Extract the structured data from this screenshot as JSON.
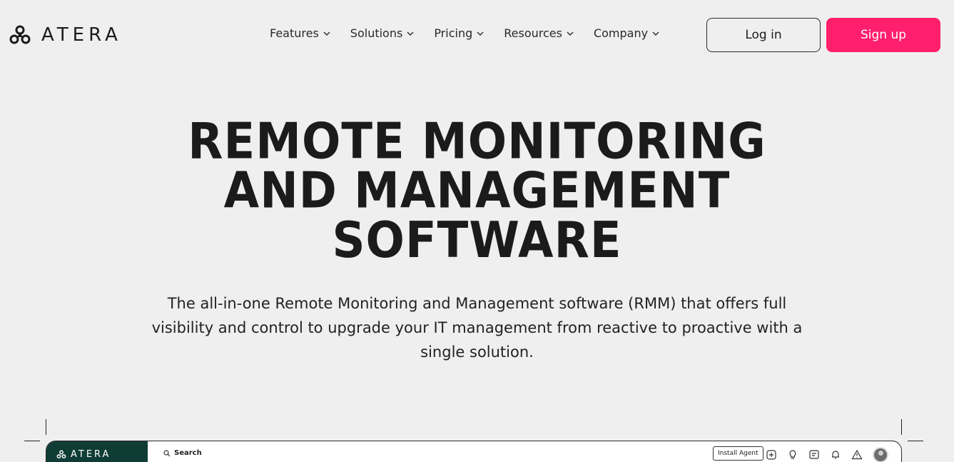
{
  "header": {
    "brand": "ATERA",
    "nav": [
      {
        "label": "Features"
      },
      {
        "label": "Solutions"
      },
      {
        "label": "Pricing"
      },
      {
        "label": "Resources"
      },
      {
        "label": "Company"
      }
    ],
    "login_label": "Log in",
    "signup_label": "Sign up"
  },
  "hero": {
    "title_lines": [
      "REMOTE MONITORING",
      "AND MANAGEMENT",
      "SOFTWARE"
    ],
    "subtitle": "The all-in-one Remote Monitoring and Management software (RMM) that offers full visibility and control to upgrade your IT management from reactive to proactive with a single solution."
  },
  "preview": {
    "brand": "ATERA",
    "search_label": "Search",
    "install_agent_label": "Install Agent",
    "icons": [
      "add-icon",
      "lightbulb-icon",
      "chat-icon",
      "bell-icon",
      "alert-icon"
    ]
  },
  "colors": {
    "background": "#efefef",
    "accent": "#ff1f6d",
    "sidebar": "#0f3d35",
    "text": "#1b1b1b"
  }
}
